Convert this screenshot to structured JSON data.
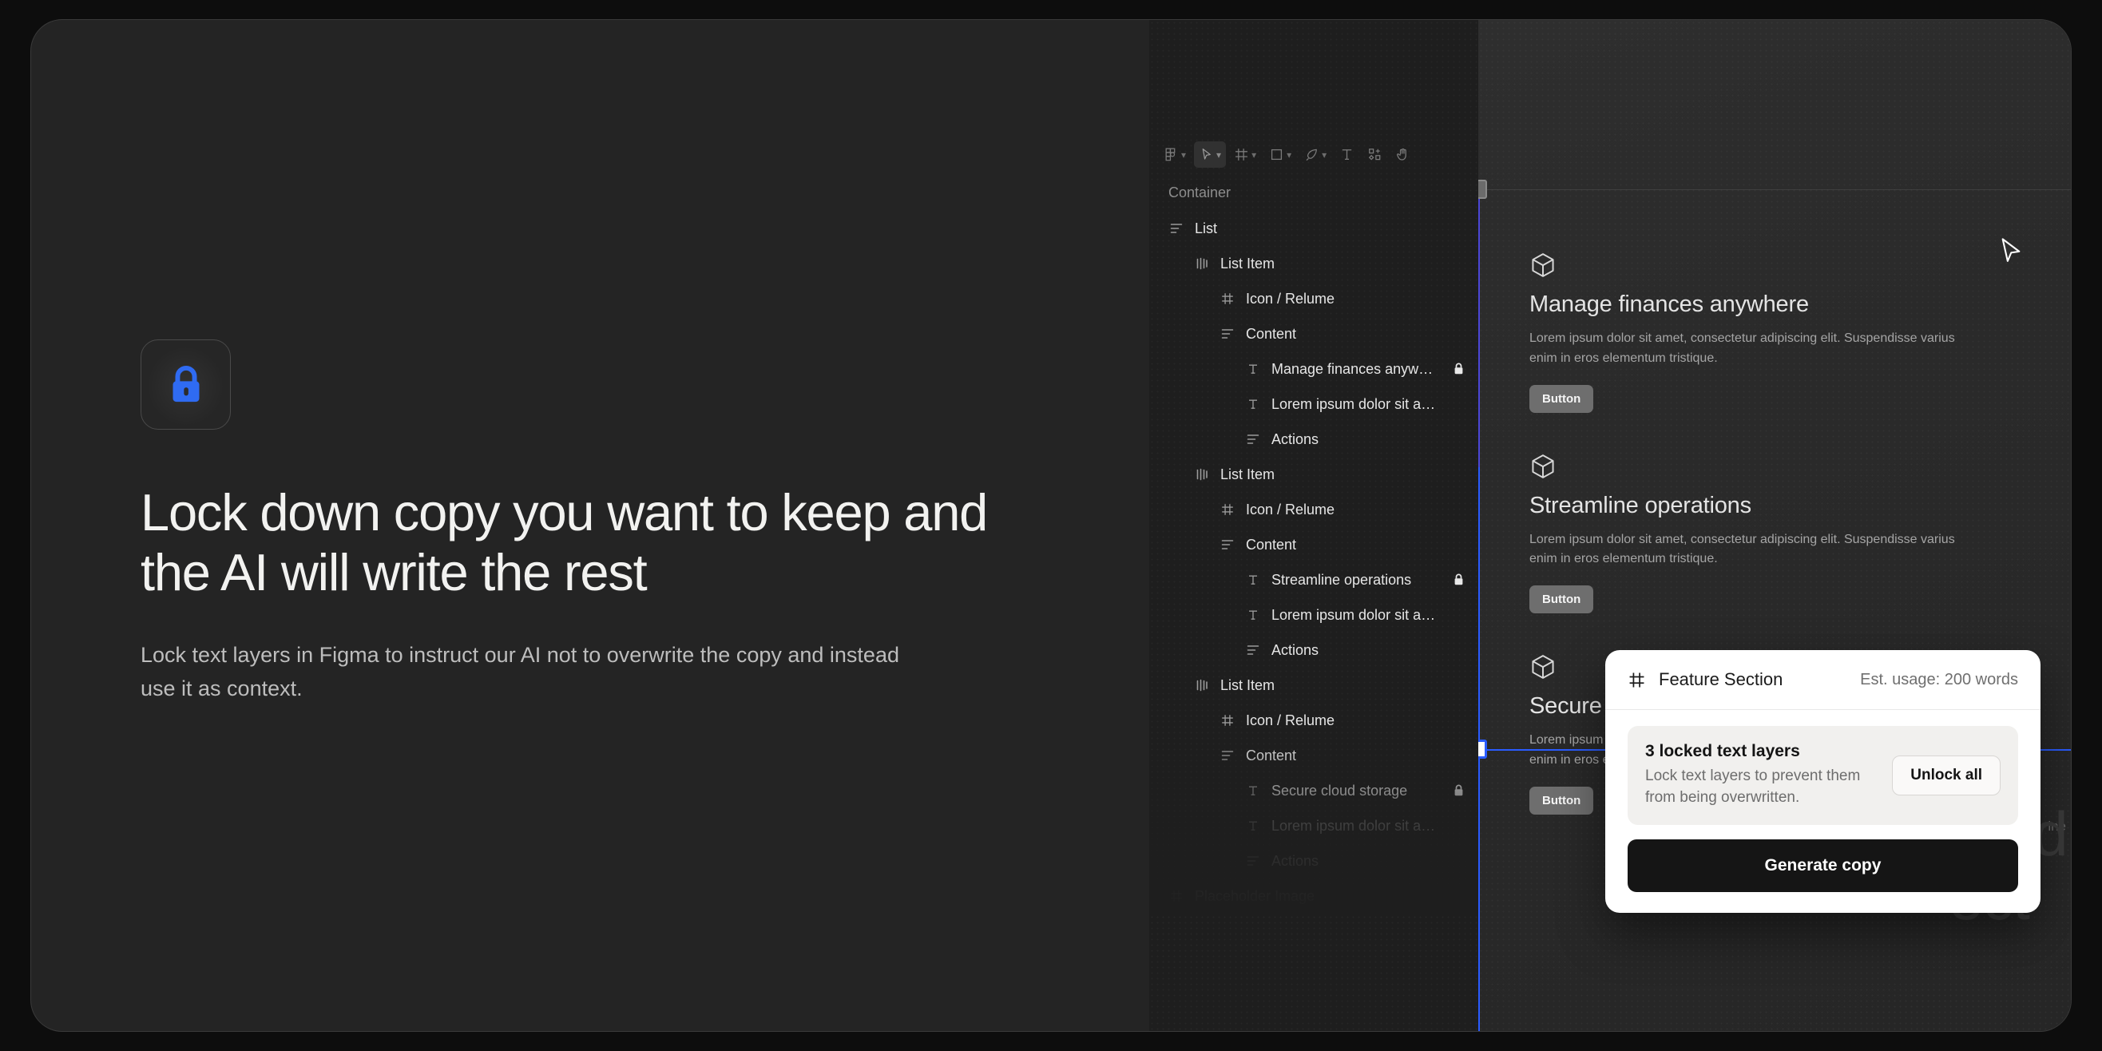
{
  "hero": {
    "icon": "lock-icon",
    "icon_color": "#2f6bf2",
    "headline": "Lock down copy you want to keep and the AI will write the rest",
    "subcopy": "Lock text layers in Figma to instruct our AI not to overwrite the copy and instead use it as context."
  },
  "figma": {
    "toolbar": [
      {
        "name": "figma-logo-icon",
        "caret": "⌄",
        "active": false
      },
      {
        "name": "move-tool-icon",
        "caret": "⌄",
        "active": true
      },
      {
        "name": "frame-tool-icon",
        "caret": "⌄",
        "active": false
      },
      {
        "name": "shape-tool-icon",
        "caret": "⌄",
        "active": false
      },
      {
        "name": "pen-tool-icon",
        "caret": "⌄",
        "active": false
      },
      {
        "name": "text-tool-icon",
        "caret": "",
        "active": false
      },
      {
        "name": "components-icon",
        "caret": "",
        "active": false
      },
      {
        "name": "hand-tool-icon",
        "caret": "",
        "active": false
      }
    ],
    "panel_title": "Container",
    "layers": [
      {
        "label": "List",
        "icon": "autolayout-icon",
        "depth": 0,
        "locked": false,
        "dim": false
      },
      {
        "label": "List Item",
        "icon": "variant-icon",
        "depth": 1,
        "locked": false,
        "dim": false
      },
      {
        "label": "Icon / Relume",
        "icon": "component-icon",
        "depth": 2,
        "locked": false,
        "dim": false
      },
      {
        "label": "Content",
        "icon": "autolayout-icon",
        "depth": 2,
        "locked": false,
        "dim": false
      },
      {
        "label": "Manage finances anywhere",
        "icon": "text-icon",
        "depth": 3,
        "locked": true,
        "dim": false
      },
      {
        "label": "Lorem ipsum dolor sit amet, conse…",
        "icon": "text-icon",
        "depth": 3,
        "locked": false,
        "dim": false
      },
      {
        "label": "Actions",
        "icon": "autolayout-icon",
        "depth": 3,
        "locked": false,
        "dim": false
      },
      {
        "label": "List Item",
        "icon": "variant-icon",
        "depth": 1,
        "locked": false,
        "dim": false
      },
      {
        "label": "Icon / Relume",
        "icon": "component-icon",
        "depth": 2,
        "locked": false,
        "dim": false
      },
      {
        "label": "Content",
        "icon": "autolayout-icon",
        "depth": 2,
        "locked": false,
        "dim": false
      },
      {
        "label": "Streamline operations",
        "icon": "text-icon",
        "depth": 3,
        "locked": true,
        "dim": false
      },
      {
        "label": "Lorem ipsum dolor sit amet, conse…",
        "icon": "text-icon",
        "depth": 3,
        "locked": false,
        "dim": false
      },
      {
        "label": "Actions",
        "icon": "autolayout-icon",
        "depth": 3,
        "locked": false,
        "dim": false
      },
      {
        "label": "List Item",
        "icon": "variant-icon",
        "depth": 1,
        "locked": false,
        "dim": false
      },
      {
        "label": "Icon / Relume",
        "icon": "component-icon",
        "depth": 2,
        "locked": false,
        "dim": false
      },
      {
        "label": "Content",
        "icon": "autolayout-icon",
        "depth": 2,
        "locked": false,
        "dim": false
      },
      {
        "label": "Secure cloud storage",
        "icon": "text-icon",
        "depth": 3,
        "locked": true,
        "dim": false
      },
      {
        "label": "Lorem ipsum dolor sit amet, conse…",
        "icon": "text-icon",
        "depth": 3,
        "locked": false,
        "dim": true
      },
      {
        "label": "Actions",
        "icon": "autolayout-icon",
        "depth": 3,
        "locked": false,
        "dim": true
      },
      {
        "label": "Placeholder Image",
        "icon": "component-icon",
        "depth": 0,
        "locked": false,
        "dim": true
      }
    ],
    "selection_color": "#2a5cff",
    "features": [
      {
        "icon": "cube-icon",
        "title": "Manage finances anywhere",
        "body": "Lorem ipsum dolor sit amet, consectetur adipiscing elit. Suspendisse varius enim in eros elementum tristique.",
        "button": "Button"
      },
      {
        "icon": "cube-icon",
        "title": "Streamline operations",
        "body": "Lorem ipsum dolor sit amet, consectetur adipiscing elit. Suspendisse varius enim in eros elementum tristique.",
        "button": "Button"
      },
      {
        "icon": "cube-icon",
        "title": "Secure cloud storage",
        "body": "Lorem ipsum dolor sit amet, consectetur adipiscing elit. Suspendisse varius enim in eros elementum tristique.",
        "button": "Button"
      }
    ],
    "background_type_line1": "Medi",
    "background_type_line2": "ect",
    "background_type_small": "ine"
  },
  "popup": {
    "icon": "component-icon",
    "title": "Feature Section",
    "usage": "Est. usage: 200 words",
    "notice": {
      "title": "3 locked text layers",
      "description": "Lock text layers to prevent them from being overwritten.",
      "action": "Unlock all"
    },
    "primary_action": "Generate copy"
  }
}
